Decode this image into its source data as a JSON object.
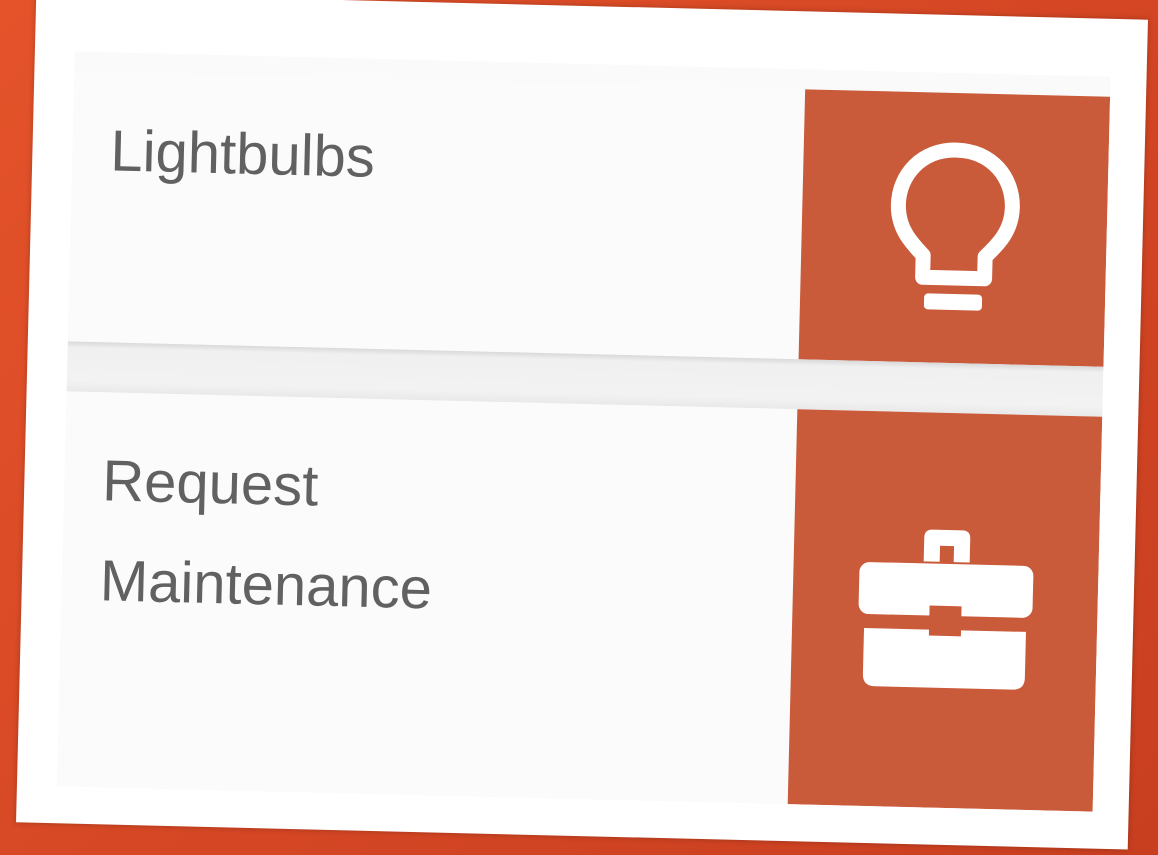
{
  "menu": {
    "items": [
      {
        "label": "Lightbulbs",
        "icon": "lightbulb-icon"
      },
      {
        "label_line1": "Request",
        "label_line2": "Maintenance",
        "icon": "toolbox-icon"
      }
    ]
  },
  "colors": {
    "accent": "#c95a3a",
    "background_frame": "#d84a26",
    "tile_background": "#fbfbfb",
    "text": "#616161"
  }
}
